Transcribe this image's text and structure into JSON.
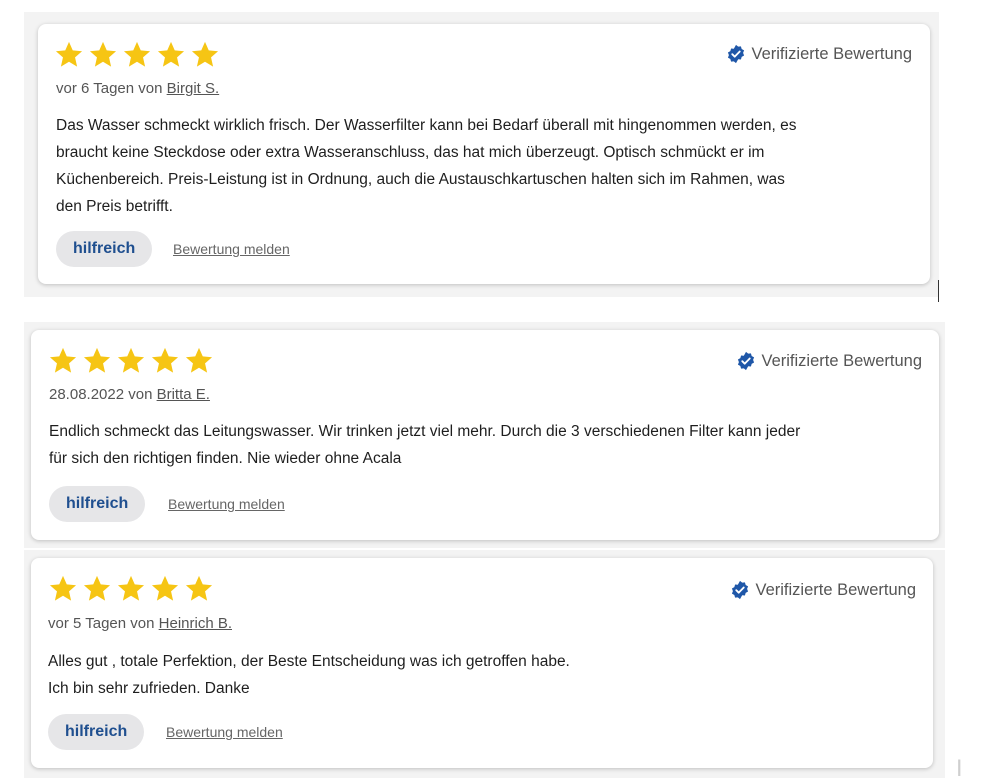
{
  "colors": {
    "star": "#f6c514",
    "verified_badge": "#1f57a8",
    "helpful_text": "#1f4f8f",
    "helpful_bg": "#e6e6e8"
  },
  "icons": {
    "star": "star-icon",
    "verified": "verified-badge-icon"
  },
  "reviews": [
    {
      "rating": 5,
      "verified_label": "Verifizierte Bewertung",
      "date_prefix": "vor 6 Tagen von ",
      "author": "Birgit S.",
      "text_lines": [
        "Das Wasser schmeckt wirklich frisch. Der Wasserfilter kann bei Bedarf überall mit hingenommen werden, es",
        "braucht keine Steckdose oder extra Wasseranschluss, das hat mich überzeugt. Optisch schmückt er im",
        "Küchenbereich. Preis-Leistung ist in Ordnung, auch die Austauschkartuschen halten sich im Rahmen, was",
        "den Preis betrifft."
      ],
      "helpful_label": "hilfreich",
      "report_label": "Bewertung melden"
    },
    {
      "rating": 5,
      "verified_label": "Verifizierte Bewertung",
      "date_prefix": "28.08.2022 von ",
      "author": "Britta E.",
      "text_lines": [
        "Endlich schmeckt das Leitungswasser. Wir trinken jetzt viel mehr. Durch die 3 verschiedenen Filter kann jeder",
        "für sich den richtigen finden. Nie wieder ohne Acala"
      ],
      "helpful_label": "hilfreich",
      "report_label": "Bewertung melden"
    },
    {
      "rating": 5,
      "verified_label": "Verifizierte Bewertung",
      "date_prefix": "vor 5 Tagen von ",
      "author": "Heinrich B.",
      "text_lines": [
        "Alles gut , totale Perfektion, der Beste Entscheidung was ich getroffen habe.",
        "Ich bin sehr zufrieden. Danke"
      ],
      "helpful_label": "hilfreich",
      "report_label": "Bewertung melden"
    }
  ]
}
